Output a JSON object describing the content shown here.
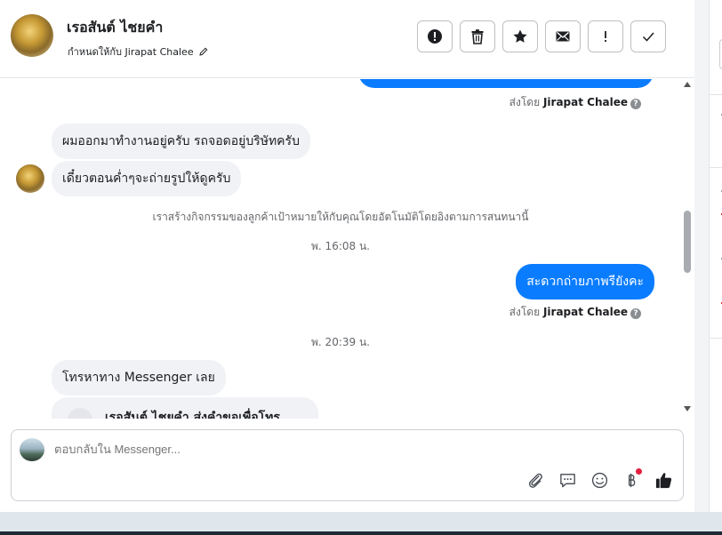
{
  "header": {
    "contact_name": "เรอสันต์ ไชยคำ",
    "assigned_to": "กำหนดให้กับ Jirapat Chalee"
  },
  "conversation": {
    "sent_by_prefix": "ส่งโดย",
    "sent_by_name": "Jirapat Chalee",
    "help_mark": "?",
    "incoming_1": "ผมออกมาทำงานอยู่ครับ รถจอดอยู่บริษัทครับ",
    "incoming_2": "เดี๋ยวตอนค่ำๆจะถ่ายรูปให้ดูครับ",
    "system_note": "เราสร้างกิจกรรมของลูกค้าเป้าหมายให้กับคุณโดยอัตโนมัติโดยอิงตามการสนทนานี้",
    "timestamp_1": "พ. 16:08 น.",
    "outgoing_2": "สะดวกถ่ายภาพรียังคะ",
    "timestamp_2": "พ. 20:39 น.",
    "incoming_3": "โทรหาทาง Messenger เลย",
    "card_text": "เรอสันต์ ไชยคำ ส่งคำขอเพื่อโทร"
  },
  "composer": {
    "placeholder": "ตอบกลับใน Messenger..."
  },
  "colors": {
    "accent": "#0a7cff",
    "incoming_bubble": "#f0f2f5",
    "badge_red": "#e41e3f"
  },
  "icons": {
    "header_actions": [
      "alert-icon",
      "trash-icon",
      "star-icon",
      "envelope-icon",
      "exclamation-icon",
      "check-icon"
    ],
    "composer_tools": [
      "paperclip-icon",
      "speech-bubble-icon",
      "smiley-icon",
      "baht-icon",
      "thumbs-up-icon"
    ]
  }
}
